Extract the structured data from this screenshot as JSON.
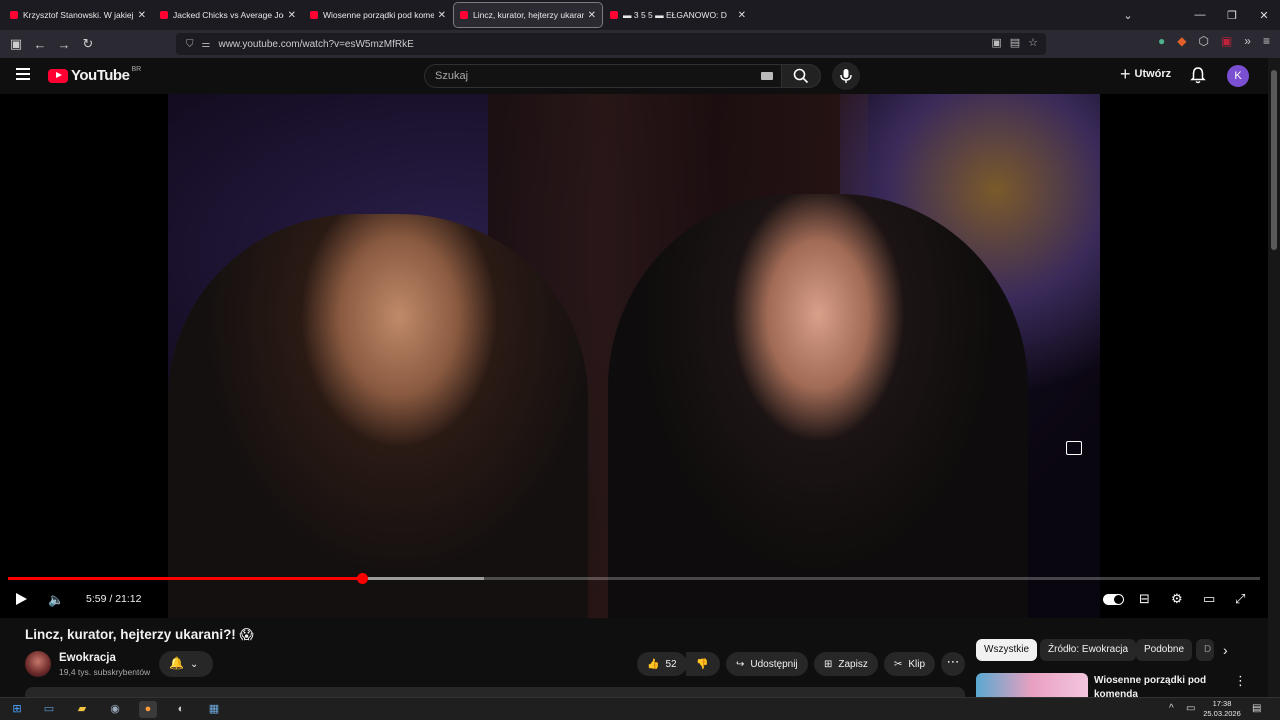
{
  "browser": {
    "tabs": [
      {
        "title": "Krzysztof Stanowski. W jakiej sp"
      },
      {
        "title": "Jacked Chicks vs Average Joes |"
      },
      {
        "title": "Wiosenne porządki pod komen"
      },
      {
        "title": "Lincz, kurator, hejterzy ukarani?"
      },
      {
        "title": "▬ 3 5 5 ▬ EŁGANOWO: D"
      }
    ],
    "url": "www.youtube.com/watch?v=esW5mzMfRkE"
  },
  "youtube": {
    "logo_text": "YouTube",
    "country_code": "BR",
    "search_placeholder": "Szukaj",
    "create_label": "Utwórz",
    "avatar_letter": "K"
  },
  "player": {
    "current_time": "5:59",
    "duration": "21:12",
    "time_display": "5:59 / 21:12",
    "played_fraction": 0.283,
    "buffered_fraction": 0.38
  },
  "video": {
    "title": "Lincz, kurator, hejterzy ukarani?! 😱",
    "channel_name": "Ewokracja",
    "subscribers": "19,4 tys. subskrybentów",
    "likes": "52",
    "share_label": "Udostępnij",
    "save_label": "Zapisz",
    "clip_label": "Klip"
  },
  "sidebar": {
    "chips": [
      "Wszystkie",
      "Źródło: Ewokracja",
      "Podobne",
      "D"
    ],
    "recommended": [
      {
        "title": "Wiosenne porządki pod komenda"
      }
    ]
  },
  "taskbar": {
    "time": "17:38",
    "date": "25.03.2026"
  },
  "colors": {
    "accent": "#ff0033",
    "progress": "#ff0000",
    "background": "#0f0f0f"
  }
}
